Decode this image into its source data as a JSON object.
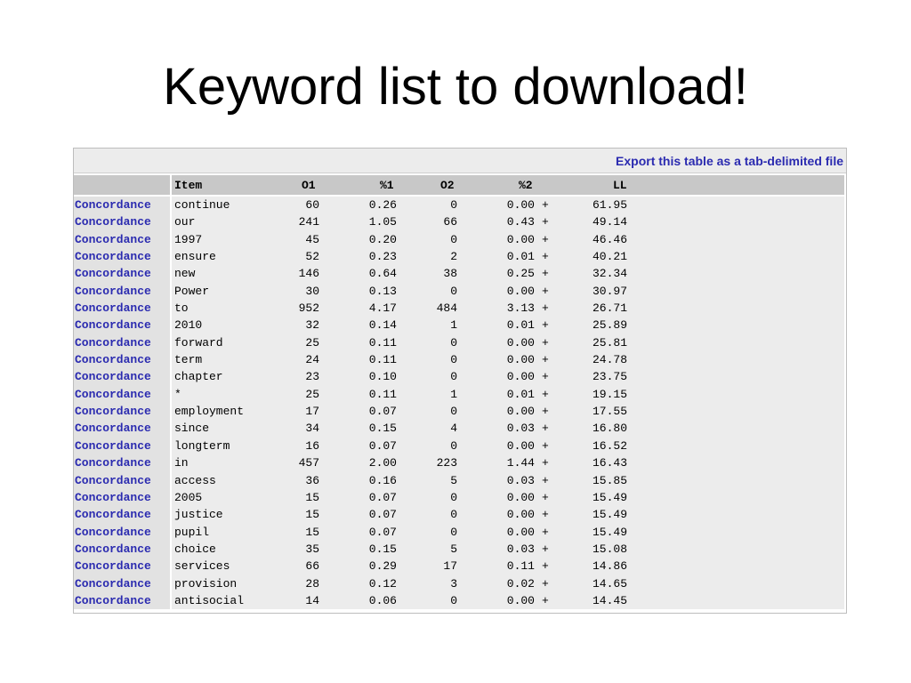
{
  "slide": {
    "title": "Keyword list to download!"
  },
  "export_link": "Export this table as a tab-delimited file",
  "columns": {
    "item": "Item",
    "o1": "O1",
    "p1": "%1",
    "o2": "O2",
    "p2": "%2",
    "ll": "LL"
  },
  "rows": [
    {
      "link": "Concordance",
      "item": "continue",
      "o1": "60",
      "p1": "0.26",
      "o2": "0",
      "p2": "0.00",
      "sign": "+",
      "ll": "61.95"
    },
    {
      "link": "Concordance",
      "item": "our",
      "o1": "241",
      "p1": "1.05",
      "o2": "66",
      "p2": "0.43",
      "sign": "+",
      "ll": "49.14"
    },
    {
      "link": "Concordance",
      "item": "1997",
      "o1": "45",
      "p1": "0.20",
      "o2": "0",
      "p2": "0.00",
      "sign": "+",
      "ll": "46.46"
    },
    {
      "link": "Concordance",
      "item": "ensure",
      "o1": "52",
      "p1": "0.23",
      "o2": "2",
      "p2": "0.01",
      "sign": "+",
      "ll": "40.21"
    },
    {
      "link": "Concordance",
      "item": "new",
      "o1": "146",
      "p1": "0.64",
      "o2": "38",
      "p2": "0.25",
      "sign": "+",
      "ll": "32.34"
    },
    {
      "link": "Concordance",
      "item": "Power",
      "o1": "30",
      "p1": "0.13",
      "o2": "0",
      "p2": "0.00",
      "sign": "+",
      "ll": "30.97"
    },
    {
      "link": "Concordance",
      "item": "to",
      "o1": "952",
      "p1": "4.17",
      "o2": "484",
      "p2": "3.13",
      "sign": "+",
      "ll": "26.71"
    },
    {
      "link": "Concordance",
      "item": "2010",
      "o1": "32",
      "p1": "0.14",
      "o2": "1",
      "p2": "0.01",
      "sign": "+",
      "ll": "25.89"
    },
    {
      "link": "Concordance",
      "item": "forward",
      "o1": "25",
      "p1": "0.11",
      "o2": "0",
      "p2": "0.00",
      "sign": "+",
      "ll": "25.81"
    },
    {
      "link": "Concordance",
      "item": "term",
      "o1": "24",
      "p1": "0.11",
      "o2": "0",
      "p2": "0.00",
      "sign": "+",
      "ll": "24.78"
    },
    {
      "link": "Concordance",
      "item": "chapter",
      "o1": "23",
      "p1": "0.10",
      "o2": "0",
      "p2": "0.00",
      "sign": "+",
      "ll": "23.75"
    },
    {
      "link": "Concordance",
      "item": "*",
      "o1": "25",
      "p1": "0.11",
      "o2": "1",
      "p2": "0.01",
      "sign": "+",
      "ll": "19.15"
    },
    {
      "link": "Concordance",
      "item": "employment",
      "o1": "17",
      "p1": "0.07",
      "o2": "0",
      "p2": "0.00",
      "sign": "+",
      "ll": "17.55"
    },
    {
      "link": "Concordance",
      "item": "since",
      "o1": "34",
      "p1": "0.15",
      "o2": "4",
      "p2": "0.03",
      "sign": "+",
      "ll": "16.80"
    },
    {
      "link": "Concordance",
      "item": "longterm",
      "o1": "16",
      "p1": "0.07",
      "o2": "0",
      "p2": "0.00",
      "sign": "+",
      "ll": "16.52"
    },
    {
      "link": "Concordance",
      "item": "in",
      "o1": "457",
      "p1": "2.00",
      "o2": "223",
      "p2": "1.44",
      "sign": "+",
      "ll": "16.43"
    },
    {
      "link": "Concordance",
      "item": "access",
      "o1": "36",
      "p1": "0.16",
      "o2": "5",
      "p2": "0.03",
      "sign": "+",
      "ll": "15.85"
    },
    {
      "link": "Concordance",
      "item": "2005",
      "o1": "15",
      "p1": "0.07",
      "o2": "0",
      "p2": "0.00",
      "sign": "+",
      "ll": "15.49"
    },
    {
      "link": "Concordance",
      "item": "justice",
      "o1": "15",
      "p1": "0.07",
      "o2": "0",
      "p2": "0.00",
      "sign": "+",
      "ll": "15.49"
    },
    {
      "link": "Concordance",
      "item": "pupil",
      "o1": "15",
      "p1": "0.07",
      "o2": "0",
      "p2": "0.00",
      "sign": "+",
      "ll": "15.49"
    },
    {
      "link": "Concordance",
      "item": "choice",
      "o1": "35",
      "p1": "0.15",
      "o2": "5",
      "p2": "0.03",
      "sign": "+",
      "ll": "15.08"
    },
    {
      "link": "Concordance",
      "item": "services",
      "o1": "66",
      "p1": "0.29",
      "o2": "17",
      "p2": "0.11",
      "sign": "+",
      "ll": "14.86"
    },
    {
      "link": "Concordance",
      "item": "provision",
      "o1": "28",
      "p1": "0.12",
      "o2": "3",
      "p2": "0.02",
      "sign": "+",
      "ll": "14.65"
    },
    {
      "link": "Concordance",
      "item": "antisocial",
      "o1": "14",
      "p1": "0.06",
      "o2": "0",
      "p2": "0.00",
      "sign": "+",
      "ll": "14.45"
    }
  ]
}
